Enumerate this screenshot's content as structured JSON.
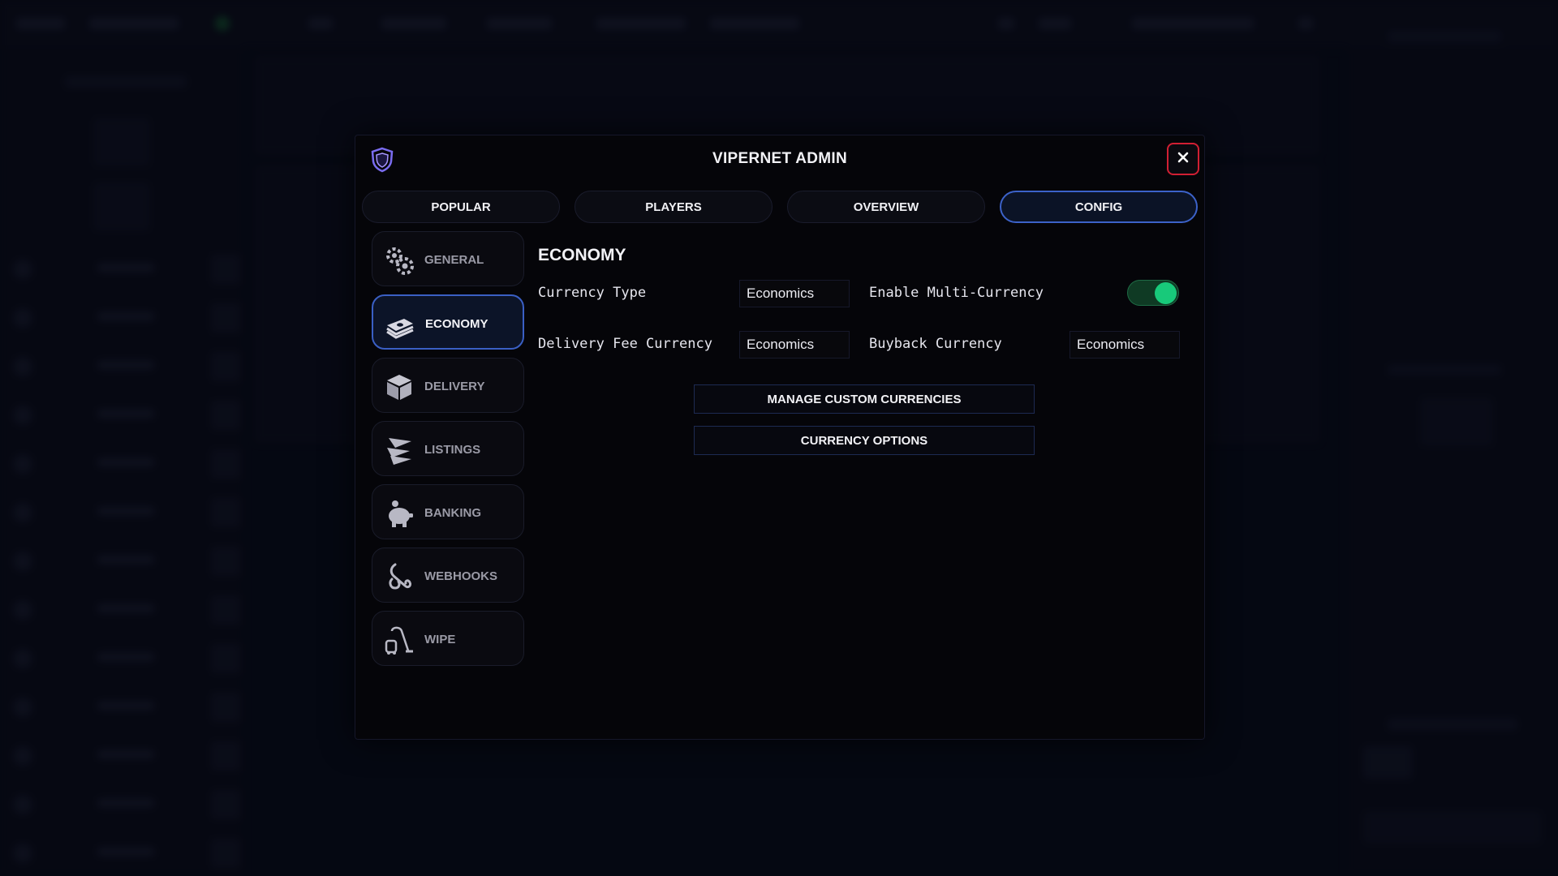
{
  "modal": {
    "title": "VIPERNET ADMIN",
    "close_label": "✕"
  },
  "tabs": [
    {
      "label": "POPULAR"
    },
    {
      "label": "PLAYERS"
    },
    {
      "label": "OVERVIEW"
    },
    {
      "label": "CONFIG",
      "active": true
    }
  ],
  "sidebar": {
    "items": [
      {
        "label": "GENERAL",
        "icon": "gears-icon"
      },
      {
        "label": "ECONOMY",
        "icon": "cash-stack-icon",
        "active": true
      },
      {
        "label": "DELIVERY",
        "icon": "box-icon"
      },
      {
        "label": "LISTINGS",
        "icon": "layers-icon"
      },
      {
        "label": "BANKING",
        "icon": "piggy-bank-icon"
      },
      {
        "label": "WEBHOOKS",
        "icon": "hook-icon"
      },
      {
        "label": "WIPE",
        "icon": "vacuum-icon"
      }
    ]
  },
  "economy": {
    "title": "ECONOMY",
    "currency_type_label": "Currency Type",
    "currency_type_value": "Economics",
    "multi_currency_label": "Enable Multi-Currency",
    "multi_currency_enabled": true,
    "delivery_fee_label": "Delivery Fee Currency",
    "delivery_fee_value": "Economics",
    "buyback_label": "Buyback Currency",
    "buyback_value": "Economics",
    "manage_button": "MANAGE CUSTOM CURRENCIES",
    "options_button": "CURRENCY OPTIONS"
  },
  "colors": {
    "accent_blue": "#3c62c9",
    "close_red": "#d11f33",
    "toggle_green": "#18c97a",
    "logo_purple": "#7a6cf0"
  }
}
